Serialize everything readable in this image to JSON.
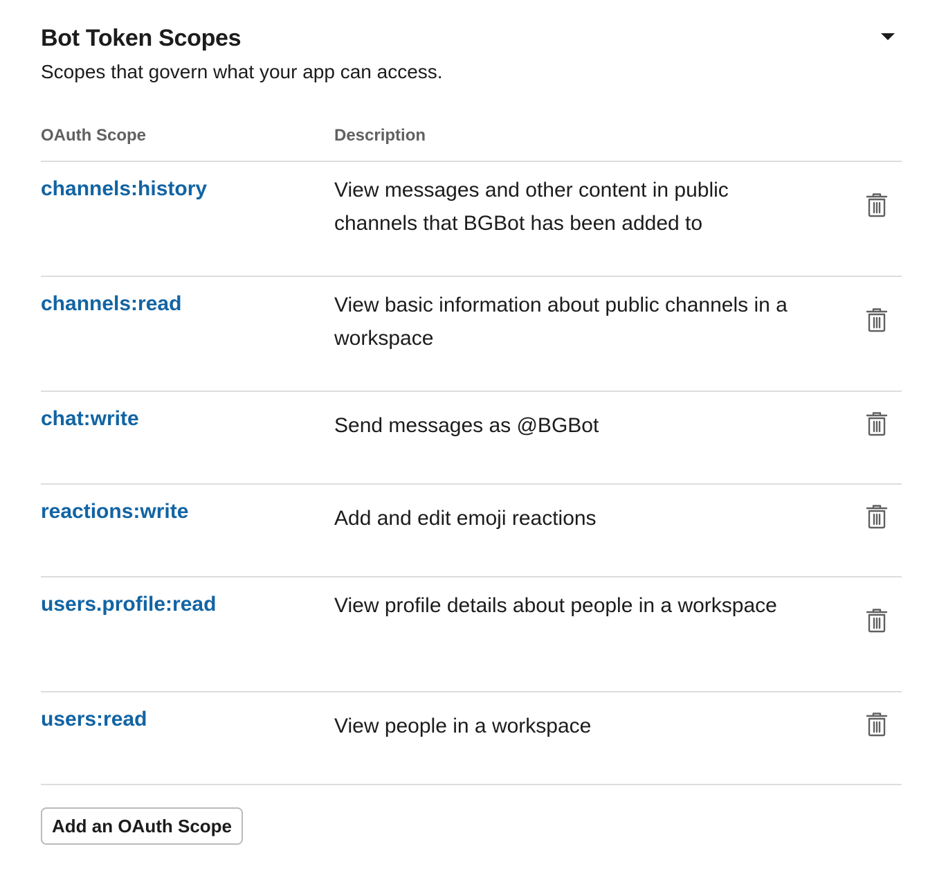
{
  "section": {
    "title": "Bot Token Scopes",
    "subtitle": "Scopes that govern what your app can access.",
    "toggle_icon": "caret-down-icon"
  },
  "table": {
    "headers": {
      "scope": "OAuth Scope",
      "description": "Description"
    },
    "rows": [
      {
        "scope": "channels:history",
        "description": "View messages and other content in public channels that BGBot has been added to",
        "action_icon": "trash-icon"
      },
      {
        "scope": "channels:read",
        "description": "View basic information about public channels in a workspace",
        "action_icon": "trash-icon"
      },
      {
        "scope": "chat:write",
        "description": "Send messages as @BGBot",
        "action_icon": "trash-icon"
      },
      {
        "scope": "reactions:write",
        "description": "Add and edit emoji reactions",
        "action_icon": "trash-icon"
      },
      {
        "scope": "users.profile:read",
        "description": "View profile details about people in a workspace",
        "action_icon": "trash-icon"
      },
      {
        "scope": "users:read",
        "description": "View people in a workspace",
        "action_icon": "trash-icon"
      }
    ]
  },
  "add_button": {
    "label": "Add an OAuth Scope"
  },
  "colors": {
    "link": "#1264a3",
    "text": "#1d1c1d",
    "header_text": "#616061",
    "divider": "#dddddd",
    "icon": "#616061"
  }
}
